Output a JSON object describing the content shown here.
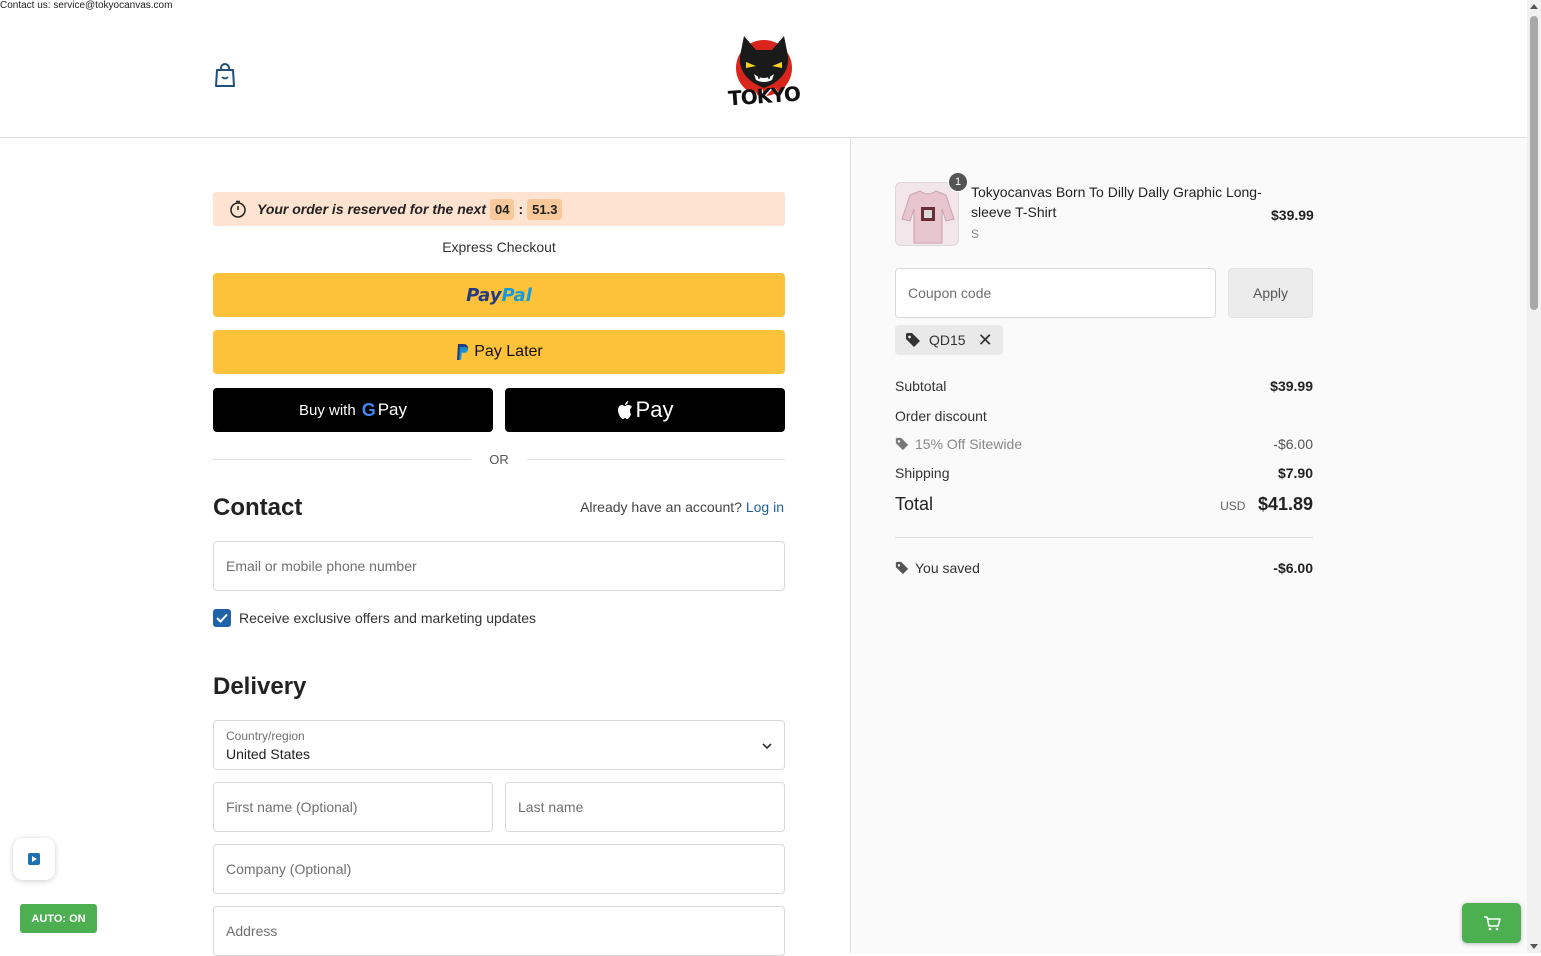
{
  "topbar": {
    "contact": "Contact us: service@tokyocanvas.com"
  },
  "header": {
    "logo_text": "TOKYO"
  },
  "timer": {
    "text": "Your order is reserved for the next",
    "minutes": "04",
    "seconds": "51.3"
  },
  "express": {
    "label": "Express Checkout",
    "paypal_label": "PayPal",
    "paylater_label": "Pay Later",
    "gpay_prefix": "Buy with",
    "gpay_label": "Pay",
    "apay_label": "Pay",
    "or_label": "OR"
  },
  "contact": {
    "heading": "Contact",
    "account_prompt": "Already have an account?",
    "login_label": "Log in",
    "email_placeholder": "Email or mobile phone number",
    "marketing_label": "Receive exclusive offers and marketing updates",
    "marketing_checked": true
  },
  "delivery": {
    "heading": "Delivery",
    "country_label": "Country/region",
    "country_value": "United States",
    "first_name_placeholder": "First name (Optional)",
    "last_name_placeholder": "Last name",
    "company_placeholder": "Company (Optional)",
    "address_placeholder": "Address"
  },
  "summary": {
    "product": {
      "name": "Tokyocanvas Born To Dilly Dally Graphic Long-sleeve T-Shirt",
      "variant": "S",
      "price": "$39.99",
      "quantity": "1"
    },
    "coupon_placeholder": "Coupon code",
    "apply_label": "Apply",
    "applied_code": "QD15",
    "subtotal_label": "Subtotal",
    "subtotal_value": "$39.99",
    "order_discount_label": "Order discount",
    "discount_name": "15% Off Sitewide",
    "discount_value": "-$6.00",
    "shipping_label": "Shipping",
    "shipping_value": "$7.90",
    "total_label": "Total",
    "currency": "USD",
    "total_value": "$41.89",
    "saved_label": "You saved",
    "saved_value": "-$6.00"
  },
  "widgets": {
    "auto_label": "AUTO: ON"
  },
  "colors": {
    "paypal_yellow": "#fec13a",
    "timer_bg": "#fde3d0",
    "checkbox_blue": "#1e63a8",
    "link_blue": "#1a5f9e",
    "auto_green": "#4caf50"
  },
  "icons": [
    "shopping-bag-icon",
    "stopwatch-icon",
    "paypal-icon",
    "google-g-icon",
    "apple-icon",
    "checkmark-icon",
    "chevron-down-icon",
    "tag-icon",
    "close-icon",
    "play-icon",
    "cart-icon"
  ]
}
